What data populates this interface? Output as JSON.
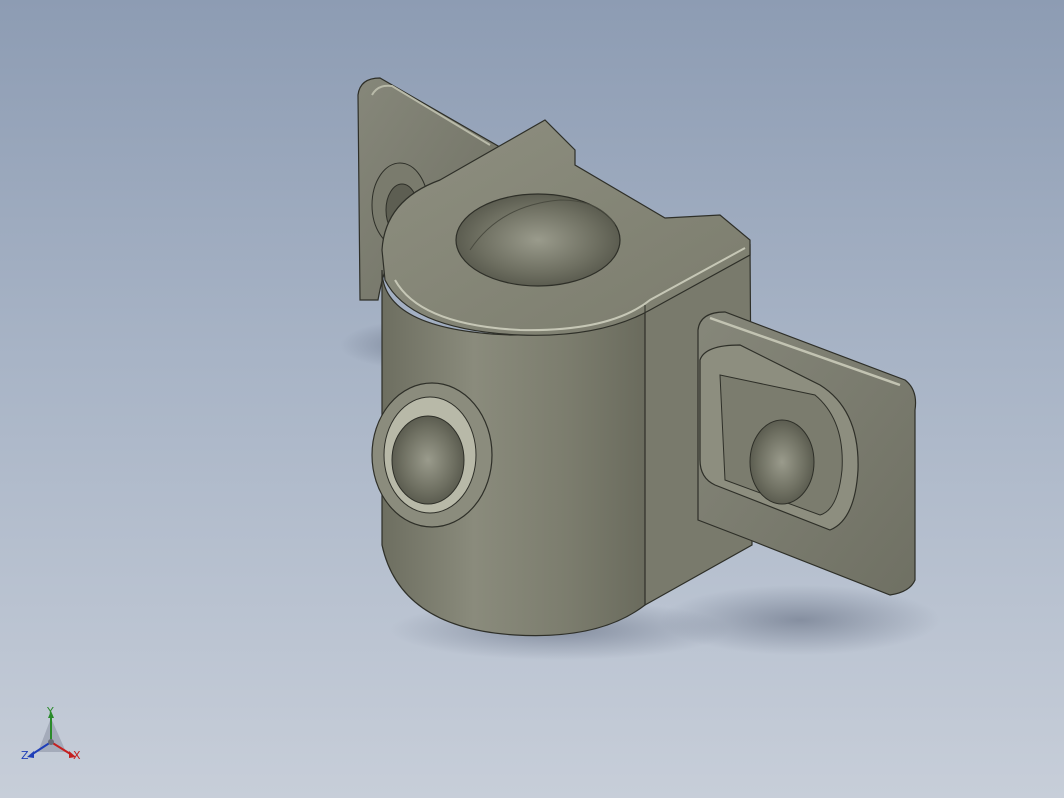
{
  "viewport": {
    "background_top": "#8d9cb3",
    "background_bottom": "#c7ced9",
    "model_color": "#7f8070"
  },
  "triad": {
    "x_label": "X",
    "y_label": "Y",
    "z_label": "Z",
    "x_color": "#c42020",
    "y_color": "#2a8a2a",
    "z_color": "#1f3fb8"
  }
}
